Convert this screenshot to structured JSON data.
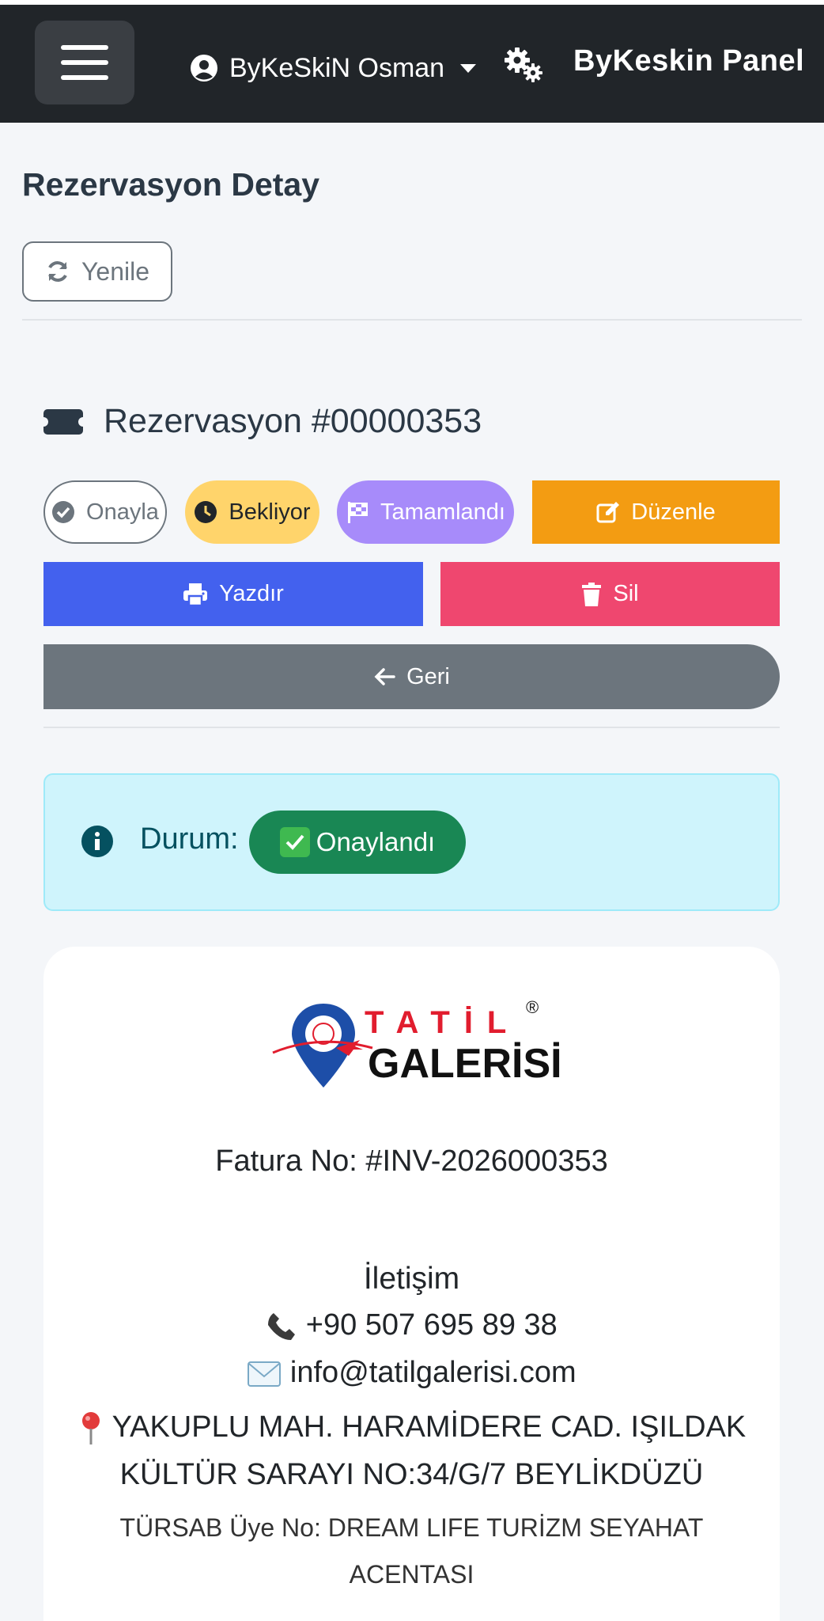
{
  "navbar": {
    "user_name": "ByKeSkiN Osman",
    "brand": "ByKeskin Panel"
  },
  "page": {
    "title": "Rezervasyon Detay",
    "refresh_label": "Yenile"
  },
  "reservation": {
    "title": "Rezervasyon #00000353",
    "actions": {
      "approve": "Onayla",
      "waiting": "Bekliyor",
      "completed": "Tamamlandı",
      "edit": "Düzenle",
      "print": "Yazdır",
      "delete": "Sil",
      "back": "Geri"
    }
  },
  "status": {
    "label": "Durum:",
    "value": "Onaylandı"
  },
  "invoice": {
    "logo_top": "TATİL",
    "logo_bottom": "GALERİSİ",
    "logo_reg": "®",
    "invoice_no": "Fatura No: #INV-2026000353",
    "contact_title": "İletişim",
    "phone": "+90 507 695 89 38",
    "email": "info@tatilgalerisi.com",
    "address": "YAKUPLU MAH. HARAMİDERE CAD. IŞILDAK KÜLTÜR SARAYI NO:34/G/7 BEYLİKDÜZÜ",
    "tursab": "TÜRSAB Üye No: DREAM LIFE TURİZM SEYAHAT ACENTASI"
  },
  "colors": {
    "navbar": "#212529",
    "approve_border": "#6c757d",
    "waiting": "#ffd46b",
    "completed": "#a78bfa",
    "edit": "#f39c12",
    "print": "#4361ee",
    "delete": "#ef476f",
    "back": "#6c757d",
    "status_badge": "#198754",
    "alert_bg": "#cff4fc"
  }
}
